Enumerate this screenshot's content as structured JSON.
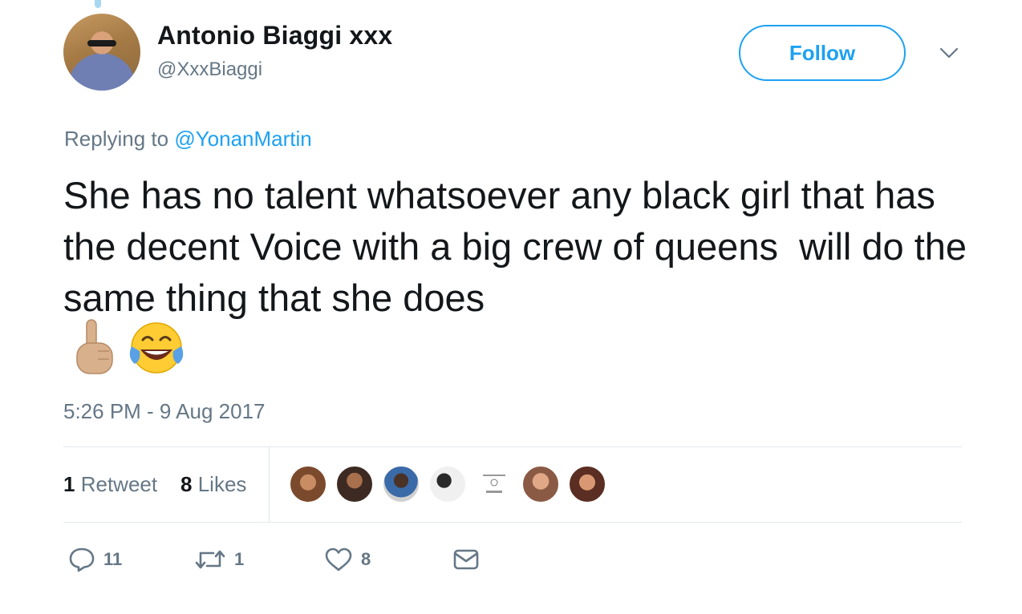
{
  "author": {
    "name": "Antonio Biaggi xxx",
    "handle": "@XxxBiaggi"
  },
  "follow_label": "Follow",
  "reply": {
    "prefix": "Replying to",
    "handle": "@YonanMartin"
  },
  "tweet_text": "She has no talent whatsoever any black girl that has the decent Voice with a big crew of queens  will do the same thing that she does",
  "emojis": [
    "middle-finger-icon",
    "face-with-tears-of-joy-icon"
  ],
  "timestamp": "5:26 PM - 9 Aug 2017",
  "stats": {
    "retweets_count": "1",
    "retweets_label": "Retweet",
    "likes_count": "8",
    "likes_label": "Likes"
  },
  "likers": [
    "liker-avatar",
    "liker-avatar",
    "liker-avatar",
    "liker-avatar",
    "liker-avatar",
    "liker-avatar",
    "liker-avatar"
  ],
  "actions": {
    "replies": "11",
    "retweets": "1",
    "likes": "8"
  },
  "colors": {
    "accent": "#1da1f2",
    "muted": "#657786",
    "text": "#14171a",
    "divider": "#e1e8ed"
  }
}
